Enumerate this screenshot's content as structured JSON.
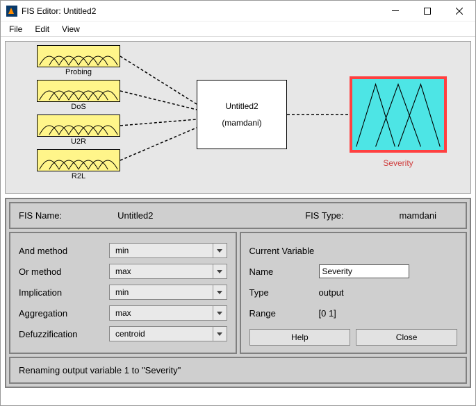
{
  "title": "FIS Editor: Untitled2",
  "menu": {
    "file": "File",
    "edit": "Edit",
    "view": "View"
  },
  "inputs": [
    {
      "label": "Probing"
    },
    {
      "label": "DoS"
    },
    {
      "label": "U2R"
    },
    {
      "label": "R2L"
    }
  ],
  "center": {
    "name": "Untitled2",
    "type": "(mamdani)"
  },
  "output": {
    "label": "Severity"
  },
  "info": {
    "fis_name_label": "FIS Name:",
    "fis_name_value": "Untitled2",
    "fis_type_label": "FIS Type:",
    "fis_type_value": "mamdani"
  },
  "methods": {
    "and": {
      "label": "And method",
      "value": "min"
    },
    "or": {
      "label": "Or method",
      "value": "max"
    },
    "imp": {
      "label": "Implication",
      "value": "min"
    },
    "agg": {
      "label": "Aggregation",
      "value": "max"
    },
    "defuzz": {
      "label": "Defuzzification",
      "value": "centroid"
    }
  },
  "current_var": {
    "heading": "Current Variable",
    "name_label": "Name",
    "name_value": "Severity",
    "type_label": "Type",
    "type_value": "output",
    "range_label": "Range",
    "range_value": "[0 1]"
  },
  "buttons": {
    "help": "Help",
    "close": "Close"
  },
  "status": "Renaming output variable 1 to \"Severity\""
}
